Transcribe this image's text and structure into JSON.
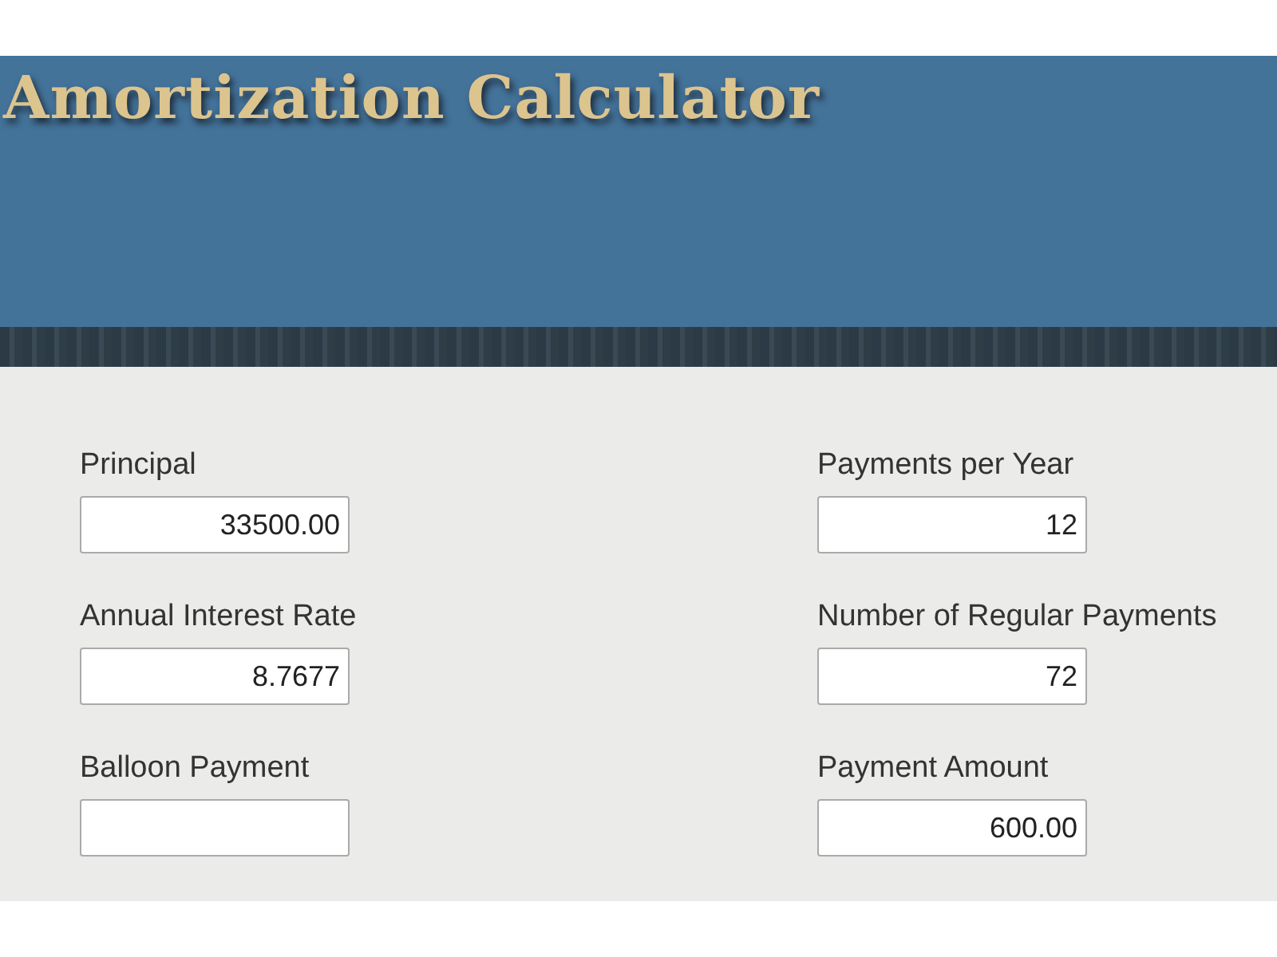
{
  "header": {
    "title": "Amortization Calculator"
  },
  "fields": [
    {
      "label": "Principal",
      "value": "33500.00"
    },
    {
      "label": "Payments per Year",
      "value": "12"
    },
    {
      "label": "Annual Interest Rate",
      "value": "8.7677"
    },
    {
      "label": "Number of Regular Payments",
      "value": "72"
    },
    {
      "label": "Balloon Payment"
    },
    {
      "label": "Payment Amount",
      "value": "600.00"
    }
  ]
}
